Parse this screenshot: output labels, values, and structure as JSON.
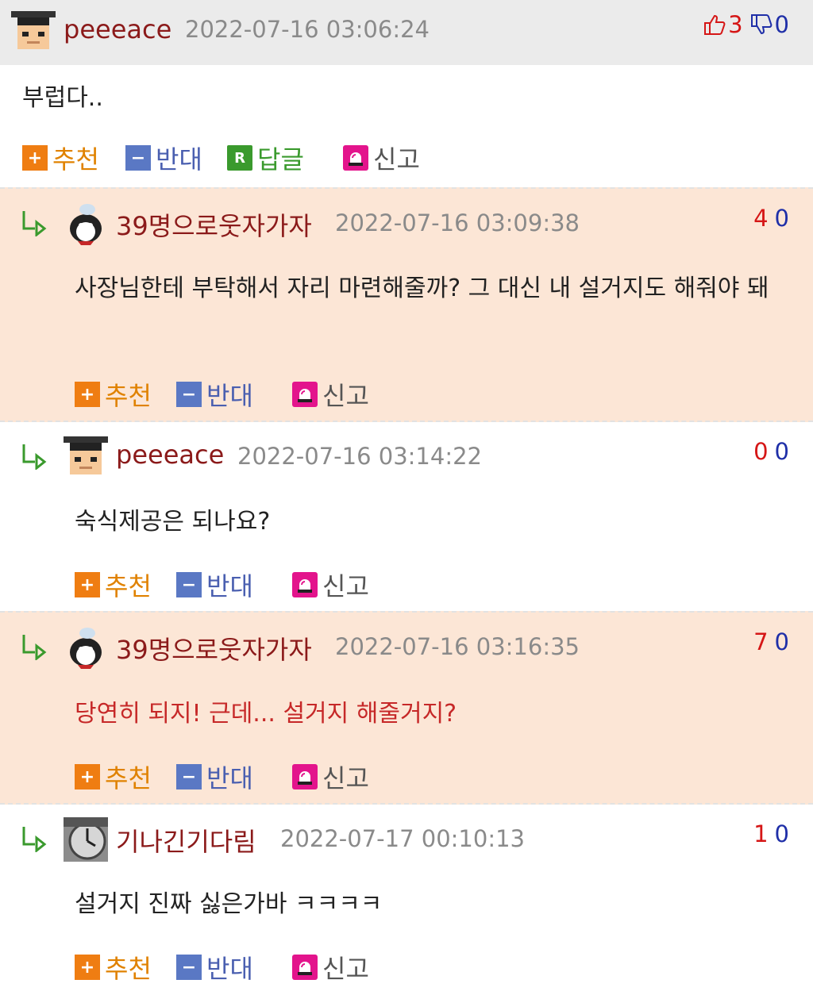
{
  "actions": {
    "recommend": "추천",
    "oppose": "반대",
    "reply": "답글",
    "report": "신고"
  },
  "comments": [
    {
      "nick": "peeeace",
      "date": "2022-07-16 03:06:24",
      "up": "3",
      "down": "0",
      "body": "부럽다.."
    },
    {
      "nick": "39명으로웃자가자",
      "date": "2022-07-16 03:09:38",
      "up": "4",
      "down": "0",
      "body": "사장님한테 부탁해서 자리 마련해줄까? 그 대신 내 설거지도 해줘야 돼"
    },
    {
      "nick": "peeeace",
      "date": "2022-07-16 03:14:22",
      "up": "0",
      "down": "0",
      "body": "숙식제공은 되나요?"
    },
    {
      "nick": "39명으로웃자가자",
      "date": "2022-07-16 03:16:35",
      "up": "7",
      "down": "0",
      "body": "당연히 되지! 근데... 설거지 해줄거지?"
    },
    {
      "nick": "기나긴기다림",
      "date": "2022-07-17 00:10:13",
      "up": "1",
      "down": "0",
      "body": "설거지 진짜 싫은가바 ㅋㅋㅋㅋ"
    }
  ],
  "colors": {
    "nick": "#8b1a1a",
    "date": "#8a8a8a",
    "up_vote": "#d51616",
    "down_vote": "#1f2fa8",
    "reply_bg": "#fce6d6",
    "header_bg": "#ebebeb",
    "highlight_text": "#c62828"
  },
  "icons": {
    "thumbs_up": "thumbs-up-icon",
    "thumbs_down": "thumbs-down-icon",
    "reply_arrow": "reply-arrow-icon",
    "plus": "plus-icon",
    "minus": "minus-icon",
    "reply_badge": "r-badge-icon",
    "siren": "siren-icon"
  }
}
